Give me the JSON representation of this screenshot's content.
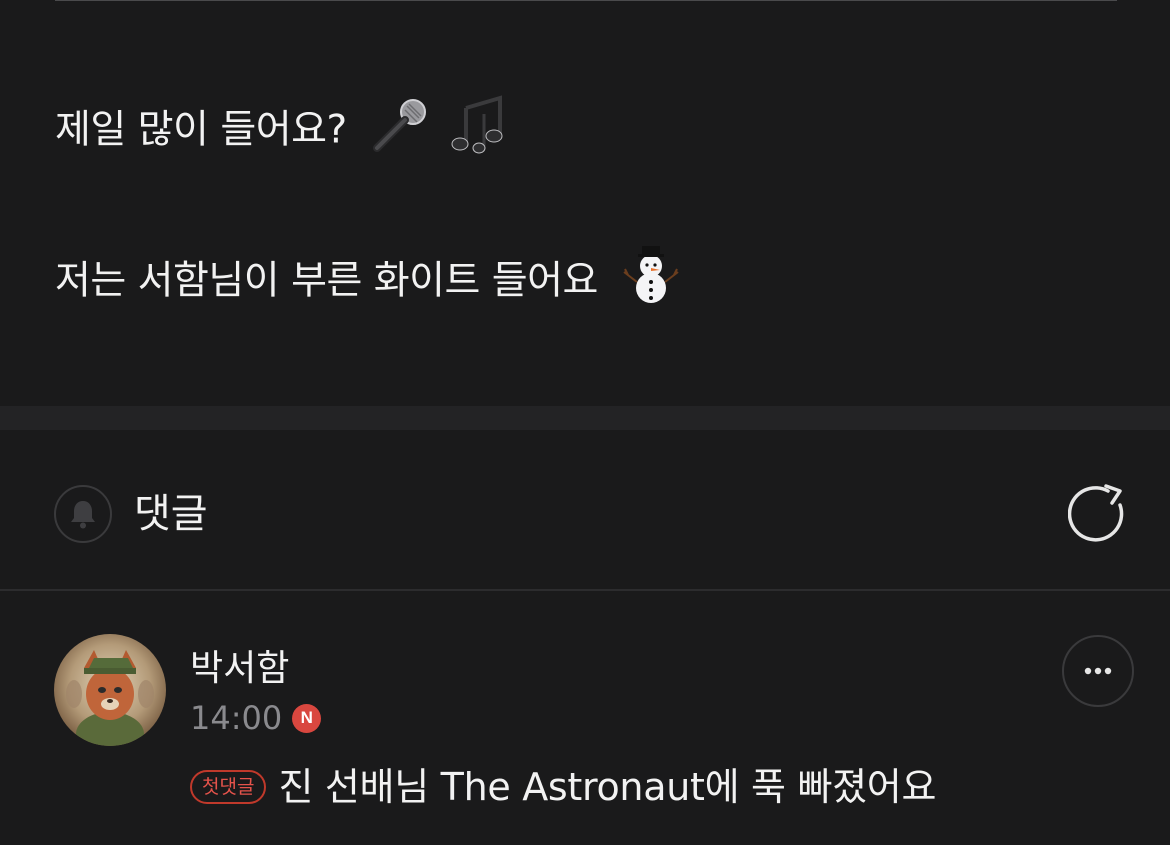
{
  "post": {
    "line1": "제일 많이 들어요?",
    "line2": "저는 서함님이 부른 화이트 들어요",
    "line1_emojis": [
      "microphone-emoji",
      "musical-notes-emoji"
    ],
    "line2_emojis": [
      "snowman-emoji"
    ]
  },
  "comments_header": {
    "title": "댓글",
    "bell_icon": "bell-icon",
    "refresh_icon": "refresh-icon"
  },
  "comments": [
    {
      "author": "박서함",
      "time": "14:00",
      "new_badge": "N",
      "first_comment_badge": "첫댓글",
      "text": "진 선배님 The Astronaut에 푹 빠졌어요"
    }
  ],
  "colors": {
    "background": "#1a1a1b",
    "text": "#f2f2f2",
    "muted": "#8a8a8e",
    "accent_red": "#d9473f"
  }
}
